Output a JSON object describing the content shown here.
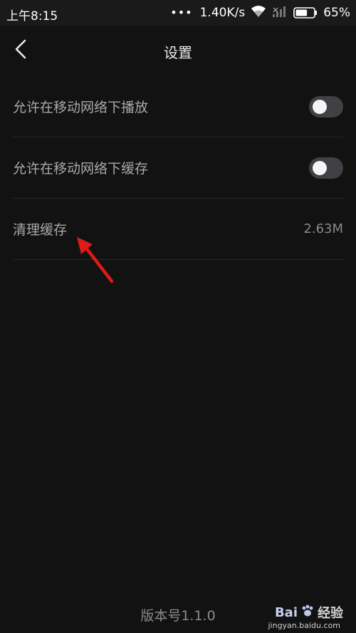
{
  "status_bar": {
    "time": "上午8:15",
    "dots": "•••",
    "network_speed": "1.40K/s",
    "battery": "65%",
    "battery_level": 0.65
  },
  "header": {
    "title": "设置"
  },
  "settings": {
    "items": [
      {
        "label": "允许在移动网络下播放",
        "toggle_on": false
      },
      {
        "label": "允许在移动网络下缓存",
        "toggle_on": false
      },
      {
        "label": "清理缓存",
        "value": "2.63M"
      }
    ]
  },
  "footer": {
    "version": "版本号1.1.0"
  },
  "watermark": {
    "brand": "Bai",
    "brand_suffix": "百",
    "name": "经验",
    "url": "jingyan.baidu.com"
  },
  "colors": {
    "background": "#121212",
    "status_bar": "#1a1a1a",
    "annotation_arrow": "#e01919",
    "toggle_off": "#3f4144"
  }
}
